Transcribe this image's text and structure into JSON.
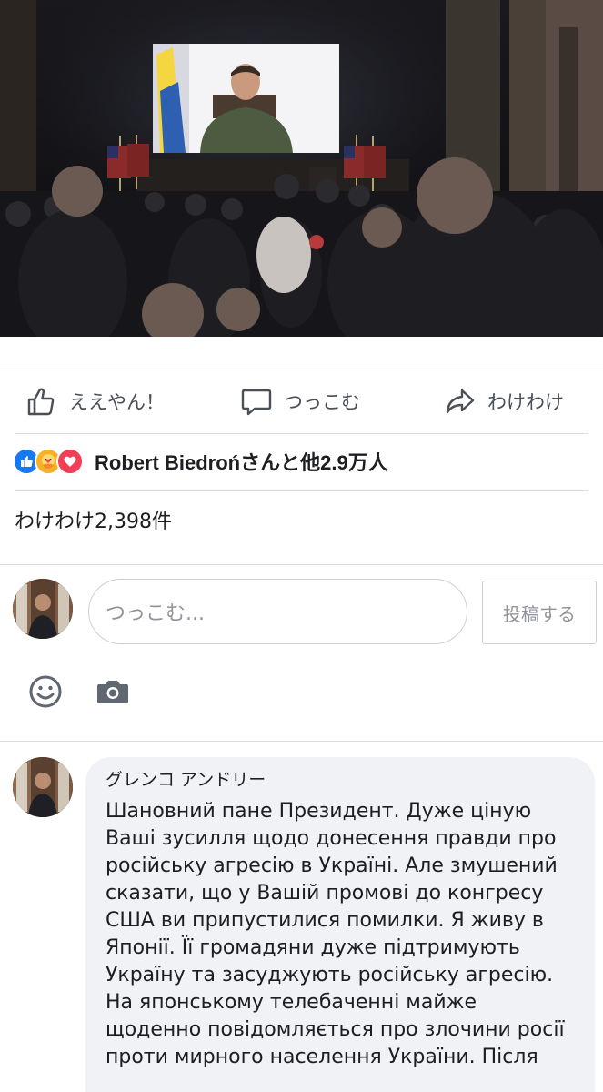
{
  "media": {
    "screen_image": "person-on-video-screen"
  },
  "actions": {
    "like_label": "ええやん！",
    "comment_label": "つっこむ",
    "share_label": "わけわけ"
  },
  "reactions": {
    "icons": [
      "like",
      "care",
      "love"
    ],
    "summary": "Robert Biedrońさんと他2.9万人"
  },
  "shares": {
    "count_text": "わけわけ2,398件"
  },
  "composer": {
    "placeholder": "つっこむ...",
    "post_label": "投稿する",
    "tools": [
      "emoji-icon",
      "camera-icon"
    ]
  },
  "comment": {
    "author": "グレンコ アンドリー",
    "text": "Шановний пане Президент. Дуже ціную Ваші зусилля щодо донесення правди про російську агресію в Україні. Але змушений сказати, що у Вашій промові до конгресу США ви припустилися помилки. Я живу в Японії. Її громадяни дуже підтримують Україну та засуджують російську агресію. На японському телебаченні майже щоденно повідомляється про злочини росії проти мирного населення України. Після"
  },
  "colors": {
    "accent": "#1877f2",
    "love": "#f33e58",
    "care": "#f7b125",
    "bubble": "#f0f2f5",
    "muted_text": "#4b4f56"
  }
}
